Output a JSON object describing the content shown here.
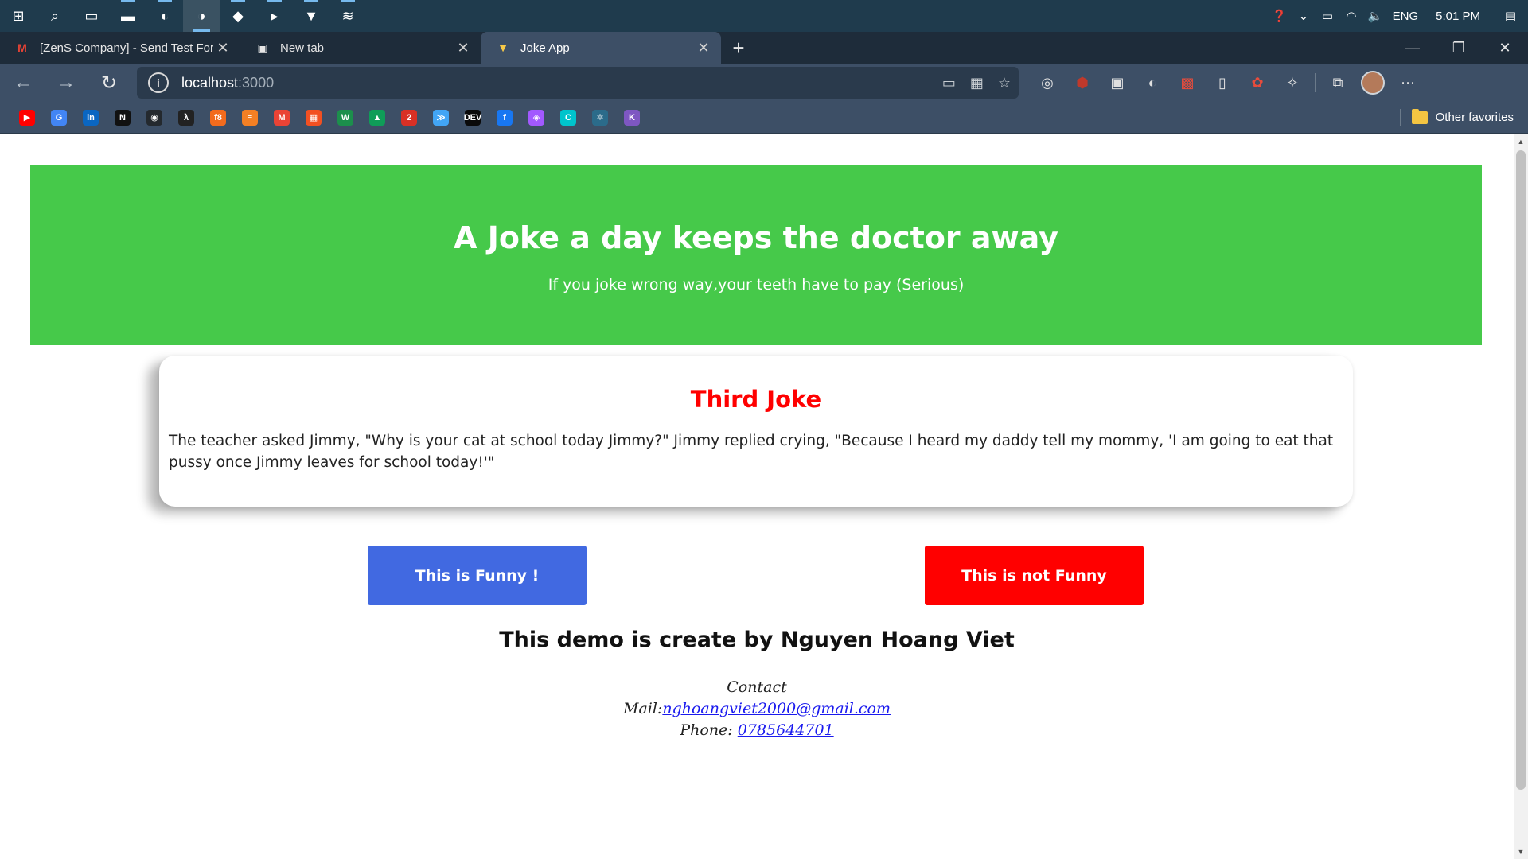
{
  "taskbar": {
    "apps": [
      {
        "name": "start",
        "glyph": "⊞"
      },
      {
        "name": "search",
        "glyph": "⌕"
      },
      {
        "name": "task-view",
        "glyph": "▭"
      },
      {
        "name": "file-explorer",
        "glyph": "▬"
      },
      {
        "name": "edge",
        "glyph": "◐"
      },
      {
        "name": "edge-dev",
        "glyph": "◑"
      },
      {
        "name": "vscode",
        "glyph": "◆"
      },
      {
        "name": "terminal",
        "glyph": "▸"
      },
      {
        "name": "brave",
        "glyph": "▼"
      },
      {
        "name": "layers",
        "glyph": "≋"
      }
    ],
    "language": "ENG",
    "time": "5:01 PM"
  },
  "tabs": [
    {
      "title": "[ZenS Company] - Send Test For",
      "favicon": "M",
      "favicon_color": "#ea4335"
    },
    {
      "title": "New tab",
      "favicon": "▣",
      "favicon_color": "#e6e6e6"
    },
    {
      "title": "Joke App",
      "favicon": "▼",
      "favicon_color": "#f7c948"
    }
  ],
  "address": {
    "host": "localhost",
    "port": ":3000"
  },
  "favorites": {
    "items": [
      {
        "name": "youtube",
        "label": "▶",
        "color": "#ff0000"
      },
      {
        "name": "google-translate",
        "label": "G",
        "color": "#4285f4"
      },
      {
        "name": "linkedin",
        "label": "in",
        "color": "#0a66c2"
      },
      {
        "name": "notion",
        "label": "N",
        "color": "#111111"
      },
      {
        "name": "github",
        "label": "◉",
        "color": "#24292e"
      },
      {
        "name": "code-lambda",
        "label": "λ",
        "color": "#222222"
      },
      {
        "name": "f8",
        "label": "f8",
        "color": "#f26b1d"
      },
      {
        "name": "stackoverflow",
        "label": "≡",
        "color": "#f48024"
      },
      {
        "name": "gmail",
        "label": "M",
        "color": "#ea4335"
      },
      {
        "name": "microsoft",
        "label": "▦",
        "color": "#f25022"
      },
      {
        "name": "w-site",
        "label": "W",
        "color": "#1c8f4c"
      },
      {
        "name": "google-drive",
        "label": "▲",
        "color": "#0f9d58"
      },
      {
        "name": "badge-site",
        "label": "2",
        "color": "#d93025"
      },
      {
        "name": "flutter",
        "label": "≫",
        "color": "#42a5f5"
      },
      {
        "name": "dev-to",
        "label": "DEV",
        "color": "#0a0a0a"
      },
      {
        "name": "facebook",
        "label": "f",
        "color": "#1877f2"
      },
      {
        "name": "figma",
        "label": "◈",
        "color": "#a259ff"
      },
      {
        "name": "canva",
        "label": "C",
        "color": "#00c4cc"
      },
      {
        "name": "react",
        "label": "⚛",
        "color": "#2b6b8a"
      },
      {
        "name": "k-site",
        "label": "K",
        "color": "#7e57c2"
      }
    ],
    "other_label": "Other favorites"
  },
  "page": {
    "hero_title": "A Joke a day keeps the doctor away",
    "hero_subtitle": "If you joke wrong way,your teeth have to pay (Serious)",
    "joke_title": "Third Joke",
    "joke_text": "The teacher asked Jimmy, \"Why is your cat at school today Jimmy?\" Jimmy replied crying, \"Because I heard my daddy tell my mommy, 'I am going to eat that pussy once Jimmy leaves for school today!'\"",
    "funny_button": "This is Funny !",
    "not_funny_button": "This is not Funny",
    "credit": "This demo is create by Nguyen Hoang Viet",
    "contact_label": "Contact",
    "mail_label": "Mail:",
    "mail": "nghoangviet2000@gmail.com",
    "phone_label": "Phone: ",
    "phone": "0785644701"
  },
  "colors": {
    "hero_bg": "#46c94a",
    "joke_title": "#ff0000",
    "funny_bg": "#4169e1",
    "not_funny_bg": "#ff0000",
    "link": "#1a1aee"
  }
}
